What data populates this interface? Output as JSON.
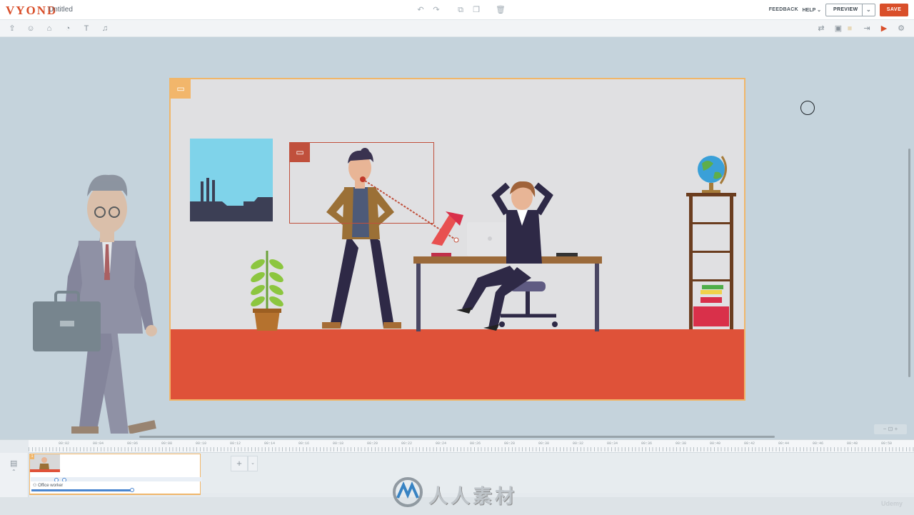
{
  "app": {
    "logo": "VYOND",
    "document_title": "Untitled"
  },
  "top_actions": {
    "feedback": "FEEDBACK",
    "help": "HELP",
    "preview": "PREVIEW",
    "save": "SAVE"
  },
  "center_tools": [
    "undo-icon",
    "redo-icon",
    "copy-icon",
    "paste-icon",
    "trash-icon"
  ],
  "left_tools": [
    "upload-icon",
    "character-icon",
    "props-icon",
    "chart-icon",
    "text-icon",
    "music-icon"
  ],
  "right_tools": [
    "swap-icon",
    "image-icon",
    "enter-icon",
    "camera-icon",
    "settings-icon"
  ],
  "timeline": {
    "ruler_ticks": [
      "00:02",
      "00:04",
      "00:06",
      "00:08",
      "00:10",
      "00:12",
      "00:14",
      "00:16",
      "00:18",
      "00:20",
      "00:22",
      "00:24",
      "00:26",
      "00:28",
      "00:30",
      "00:32",
      "00:34",
      "00:36",
      "00:38",
      "00:40",
      "00:42",
      "00:44",
      "00:46",
      "00:48",
      "00:50"
    ],
    "scene_number": "1",
    "actor_label": "Office worker"
  },
  "watermark": {
    "text": "人人素材"
  },
  "branding": {
    "udemy": "Udemy"
  },
  "colors": {
    "accent": "#d94f2a",
    "scene_border": "#f0b66a",
    "floor": "#df5239",
    "wall": "#e0e0e2",
    "selection": "#c0503c"
  }
}
